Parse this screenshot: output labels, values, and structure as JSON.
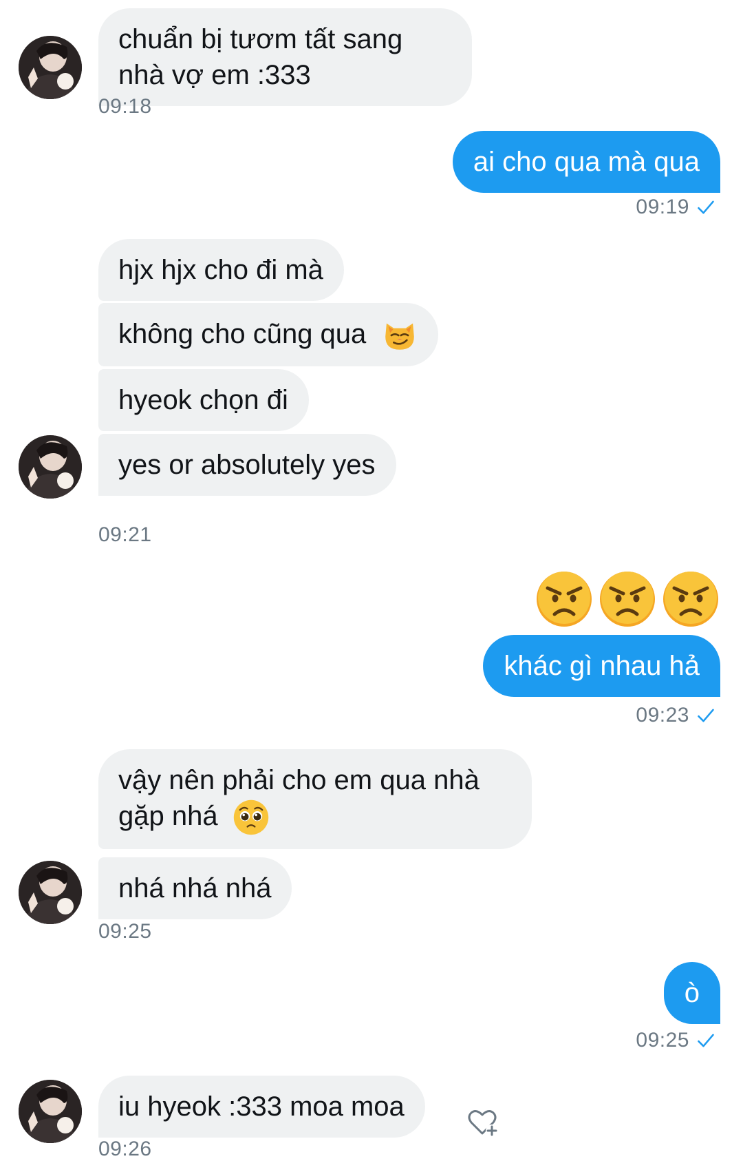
{
  "messages": {
    "m1": {
      "text": "chuẩn bị tươm tất sang nhà vợ em :333",
      "time": "09:18"
    },
    "m2": {
      "text": "ai cho qua mà qua",
      "time": "09:19"
    },
    "m3": {
      "text": "hjx hjx cho đi mà"
    },
    "m4": {
      "text": "không cho cũng qua",
      "emoji": "smirk-cat-emoji"
    },
    "m5": {
      "text": "hyeok chọn đi"
    },
    "m6": {
      "text": "yes or absolutely yes",
      "time": "09:21"
    },
    "m7": {
      "emoji": [
        "angry-face-emoji",
        "angry-face-emoji",
        "angry-face-emoji"
      ]
    },
    "m8": {
      "text": "khác gì nhau hả",
      "time": "09:23"
    },
    "m9": {
      "text": "vậy nên phải cho em qua nhà gặp nhá",
      "emoji": "pleading-face-emoji"
    },
    "m10": {
      "text": "nhá nhá nhá",
      "time": "09:25"
    },
    "m11": {
      "text": "ò",
      "time": "09:25"
    },
    "m12": {
      "text": "iu hyeok :333 moa moa",
      "time": "09:26"
    }
  },
  "colors": {
    "incoming_bubble": "#eff1f2",
    "outgoing_bubble": "#1d9bf0",
    "timestamp": "#6b7883",
    "read_check": "#1d9bf0"
  }
}
